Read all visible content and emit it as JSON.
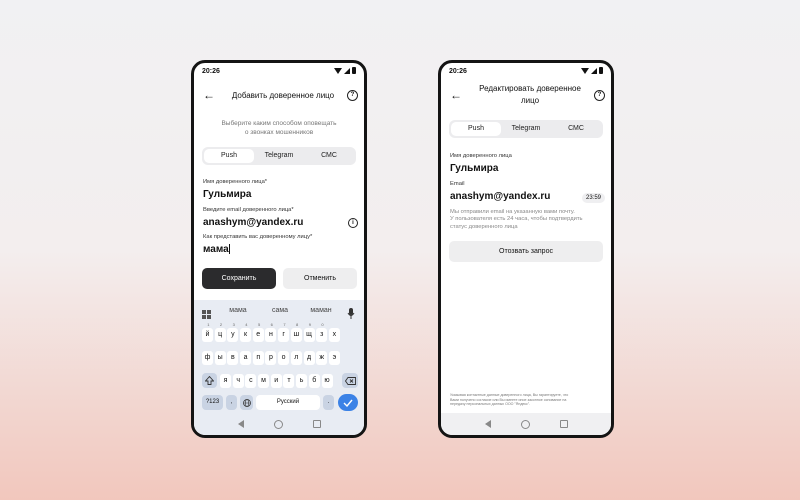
{
  "status_time": "20:26",
  "screen1": {
    "title": "Добавить доверенное лицо",
    "subtitle_line1": "Выберите каким способом оповещать",
    "subtitle_line2": "о звонках мошенников",
    "tabs": [
      "Push",
      "Telegram",
      "СМС"
    ],
    "name_label": "Имя доверенного лица*",
    "name_value": "Гульмира",
    "email_label": "Введите email доверенного лица*",
    "email_value": "anashym@yandex.ru",
    "relation_label": "Как представить вас доверенному лицу*",
    "relation_value": "мама",
    "save_label": "Сохранить",
    "cancel_label": "Отменить",
    "keyboard": {
      "suggestions": [
        "мама",
        "сама",
        "маман"
      ],
      "row1": [
        "й",
        "ц",
        "у",
        "к",
        "е",
        "н",
        "г",
        "ш",
        "щ",
        "з",
        "х"
      ],
      "row1_hints": [
        "1",
        "2",
        "3",
        "4",
        "5",
        "6",
        "7",
        "8",
        "9",
        "0"
      ],
      "row2": [
        "ф",
        "ы",
        "в",
        "а",
        "п",
        "р",
        "о",
        "л",
        "д",
        "ж",
        "э"
      ],
      "row3": [
        "я",
        "ч",
        "с",
        "м",
        "и",
        "т",
        "ь",
        "б",
        "ю"
      ],
      "num_label": "?123",
      "comma_label": ",",
      "space_label": "Русский",
      "period_label": "."
    }
  },
  "screen2": {
    "title_line1": "Редактировать доверенное",
    "title_line2": "лицо",
    "tabs": [
      "Push",
      "Telegram",
      "СМС"
    ],
    "name_label": "Имя доверенного лица",
    "name_value": "Гульмира",
    "email_label": "Email",
    "email_value": "anashym@yandex.ru",
    "timer": "23:59",
    "notice_lines": [
      "Мы отправили email на указанную вами почту.",
      "У пользователя есть 24 часа, чтобы подтвердить",
      "статус доверенного лица"
    ],
    "revoke_label": "Отозвать запрос",
    "footer_lines": [
      "Указывая контактные данные доверенного лица, Вы гарантируете, что",
      "Вами получено согласие или Вы имеете иное законное основание на",
      "передачу персональных данных ООО \"Яндекс\"."
    ]
  }
}
